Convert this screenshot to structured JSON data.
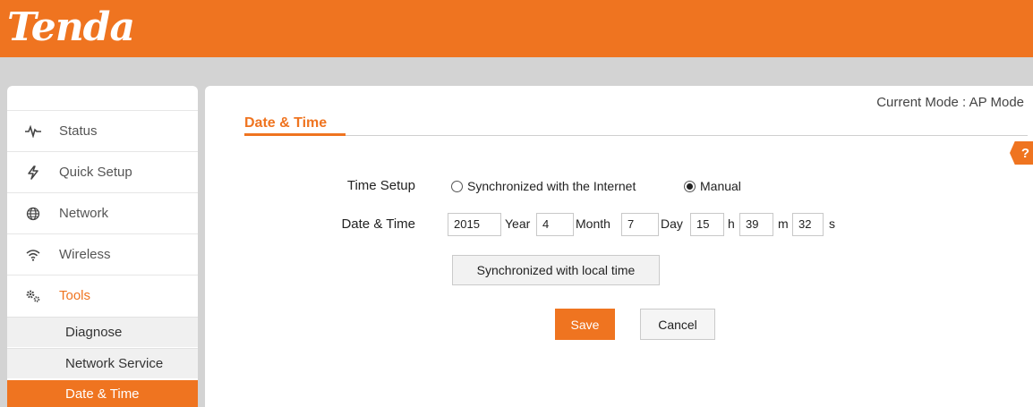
{
  "brand": {
    "logo_text": "Tenda",
    "accent": "#ef7420",
    "gray_bg": "#d3d3d3"
  },
  "header": {
    "current_mode": "Current Mode : AP Mode"
  },
  "sidebar": {
    "items": [
      {
        "label": "Status",
        "icon": "pulse-icon"
      },
      {
        "label": "Quick Setup",
        "icon": "lightning-icon"
      },
      {
        "label": "Network",
        "icon": "globe-icon"
      },
      {
        "label": "Wireless",
        "icon": "wifi-icon"
      },
      {
        "label": "Tools",
        "icon": "gears-icon",
        "active": true
      }
    ],
    "subitems": [
      {
        "label": "Diagnose"
      },
      {
        "label": "Network Service"
      },
      {
        "label": "Date & Time",
        "selected": true
      }
    ]
  },
  "page": {
    "title": "Date & Time",
    "help_icon_text": "?",
    "time_setup": {
      "label": "Time Setup",
      "options": [
        {
          "label": "Synchronized with the Internet",
          "checked": false
        },
        {
          "label": "Manual",
          "checked": true
        }
      ]
    },
    "date_time": {
      "label": "Date & Time",
      "year": {
        "value": "2015",
        "unit": "Year"
      },
      "month": {
        "value": "4",
        "unit": "Month"
      },
      "day": {
        "value": "7",
        "unit": "Day"
      },
      "hour": {
        "value": "15",
        "unit": "h"
      },
      "minute": {
        "value": "39",
        "unit": "m"
      },
      "second": {
        "value": "32",
        "unit": "s"
      }
    },
    "sync_button": "Synchronized with local time",
    "save_button": "Save",
    "cancel_button": "Cancel"
  }
}
